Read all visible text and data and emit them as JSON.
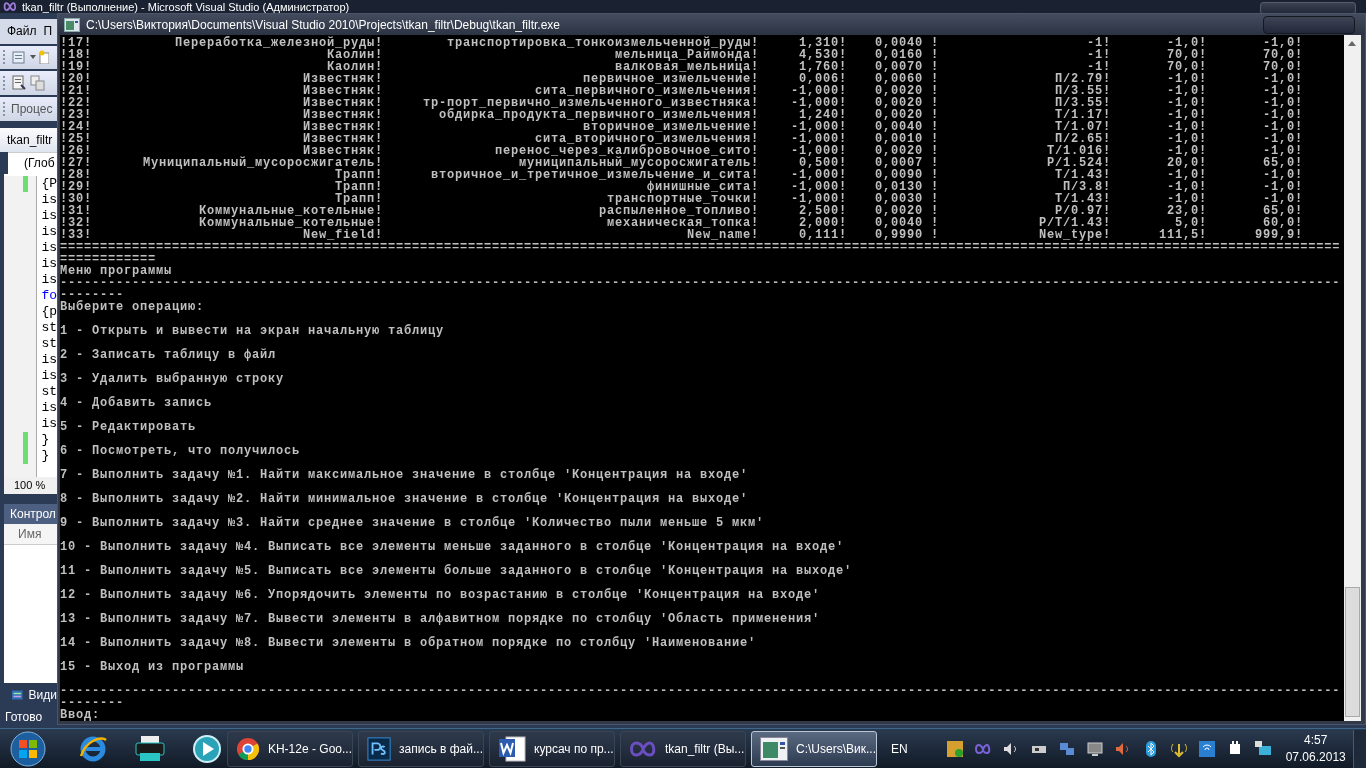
{
  "ide": {
    "title": "tkan_filtr (Выполнение) - Microsoft Visual Studio (Администратор)",
    "menu": [
      "Файл",
      "П"
    ],
    "toolbar_label": "Процес",
    "document_tab": "tkan_filtr",
    "scope_dropdown": "(Глоб",
    "code_lines": [
      {
        "text": "{P",
        "kind": "plain",
        "changed": true
      },
      {
        "text": "is",
        "kind": "plain",
        "changed": false
      },
      {
        "text": "is",
        "kind": "plain",
        "changed": false
      },
      {
        "text": "is",
        "kind": "plain",
        "changed": false
      },
      {
        "text": "is",
        "kind": "plain",
        "changed": false
      },
      {
        "text": "is",
        "kind": "plain",
        "changed": false
      },
      {
        "text": "is",
        "kind": "plain",
        "changed": false
      },
      {
        "text": "fo",
        "kind": "keyword",
        "changed": false
      },
      {
        "text": "{p",
        "kind": "plain",
        "changed": false
      },
      {
        "text": "st",
        "kind": "plain",
        "changed": false
      },
      {
        "text": "st",
        "kind": "plain",
        "changed": false
      },
      {
        "text": "is",
        "kind": "plain",
        "changed": false
      },
      {
        "text": "is",
        "kind": "plain",
        "changed": false
      },
      {
        "text": "st",
        "kind": "plain",
        "changed": false
      },
      {
        "text": "is",
        "kind": "plain",
        "changed": false
      },
      {
        "text": "is",
        "kind": "plain",
        "changed": false
      },
      {
        "text": "}",
        "kind": "plain",
        "changed": true
      },
      {
        "text": "}",
        "kind": "plain",
        "changed": true
      }
    ],
    "zoom": "100 %",
    "panel_title": "Контрол",
    "panel_column": "Имя",
    "bottom_tab": "Види",
    "status": "Готово"
  },
  "console": {
    "title": "C:\\Users\\Виктория\\Documents\\Visual Studio 2010\\Projects\\tkan_filtr\\Debug\\tkan_filtr.exe",
    "rows": [
      [
        "!17!",
        "Переработка_железной_руды!",
        "транспортировка_тонкоизмельченной_руды!",
        "1,310!",
        "0,0040 !",
        "-1!",
        "-1,0!",
        "-1,0!"
      ],
      [
        "!18!",
        "Каолин!",
        "мельница_Раймонда!",
        "4,530!",
        "0,0160 !",
        "-1!",
        "70,0!",
        "70,0!"
      ],
      [
        "!19!",
        "Каолин!",
        "валковая_мельница!",
        "1,760!",
        "0,0070 !",
        "-1!",
        "70,0!",
        "70,0!"
      ],
      [
        "!20!",
        "Известняк!",
        "первичное_измельчение!",
        "0,006!",
        "0,0060 !",
        "П/2.79!",
        "-1,0!",
        "-1,0!"
      ],
      [
        "!21!",
        "Известняк!",
        "сита_первичного_измельчения!",
        "-1,000!",
        "0,0020 !",
        "П/3.55!",
        "-1,0!",
        "-1,0!"
      ],
      [
        "!22!",
        "Известняк!",
        "тр-порт_первично_измельченного_известняка!",
        "-1,000!",
        "0,0020 !",
        "П/3.55!",
        "-1,0!",
        "-1,0!"
      ],
      [
        "!23!",
        "Известняк!",
        "обдирка_продукта_первичного_измельчения!",
        "1,240!",
        "0,0020 !",
        "Т/1.17!",
        "-1,0!",
        "-1,0!"
      ],
      [
        "!24!",
        "Известняк!",
        "вторичное_измельчение!",
        "-1,000!",
        "0,0040 !",
        "Т/1.07!",
        "-1,0!",
        "-1,0!"
      ],
      [
        "!25!",
        "Известняк!",
        "сита_вторичного_измельчения!",
        "-1,000!",
        "0,0010 !",
        "П/2.65!",
        "-1,0!",
        "-1,0!"
      ],
      [
        "!26!",
        "Известняк!",
        "перенос_через_калибровочное_сито!",
        "-1,000!",
        "0,0020 !",
        "Т/1.016!",
        "-1,0!",
        "-1,0!"
      ],
      [
        "!27!",
        "Муниципальный_мусоросжигатель!",
        "муниципальный_мусоросжигатель!",
        "0,500!",
        "0,0007 !",
        "Р/1.524!",
        "20,0!",
        "65,0!"
      ],
      [
        "!28!",
        "Трапп!",
        "вторичное_и_третичное_измельчение_и_сита!",
        "-1,000!",
        "0,0090 !",
        "Т/1.43!",
        "-1,0!",
        "-1,0!"
      ],
      [
        "!29!",
        "Трапп!",
        "финишные_сита!",
        "-1,000!",
        "0,0130 !",
        "П/3.8!",
        "-1,0!",
        "-1,0!"
      ],
      [
        "!30!",
        "Трапп!",
        "транспортные_точки!",
        "-1,000!",
        "0,0030 !",
        "Т/1.43!",
        "-1,0!",
        "-1,0!"
      ],
      [
        "!31!",
        "Коммунальные_котельные!",
        "распыленное_топливо!",
        "2,500!",
        "0,0020 !",
        "Р/0.97!",
        "23,0!",
        "65,0!"
      ],
      [
        "!32!",
        "Коммунальные_котельные!",
        "механическая_топка!",
        "2,000!",
        "0,0040 !",
        "Р/Т/1.43!",
        "5,0!",
        "60,0!"
      ],
      [
        "!33!",
        "New_field!",
        "New_name!",
        "0,111!",
        "0,9990 !",
        "New_type!",
        "111,5!",
        "999,9!"
      ]
    ],
    "rule_top": "================================================================================================================================================================",
    "rule_top_wrap": "============",
    "menu_title": "Меню программы",
    "rule_mid": "----------------------------------------------------------------------------------------------------------------------------------------------------------------",
    "rule_mid_wrap": "--------",
    "prompt": "Выберите операцию:",
    "options": [
      "1 - Открыть и вывести на экран начальную таблицу",
      "2 - Записать таблицу в файл",
      "3 - Удалить выбранную строку",
      "4 - Добавить запись",
      "5 - Редактировать",
      "6 - Посмотреть, что получилось",
      "7 - Выполнить задачу №1. Найти максимальное значение в столбце 'Концентрация на входе'",
      "8 - Выполнить задачу №2. Найти минимальное значение в столбце 'Концентрация на выходе'",
      "9 - Выполнить задачу №3. Найти среднее значение в столбце 'Количество пыли меньше 5 мкм'",
      "10 - Выполнить задачу №4. Выписать все элементы меньше заданного в столбце 'Концентрация на входе'",
      "11 - Выполнить задачу №5. Выписать все элементы больше заданного в столбце 'Концентрация на выходе'",
      "12 - Выполнить задачу №6. Упорядочить элементы по возрастанию в столбце 'Концентрация на входе'",
      "13 - Выполнить задачу №7. Вывести элементы в алфавитном порядке по столбцу 'Область применения'",
      "14 - Выполнить задачу №8. Вывести элементы в обратном порядке по столбцу 'Наименование'",
      "15 - Выход из программы"
    ],
    "rule_bottom": "----------------------------------------------------------------------------------------------------------------------------------------------------------------",
    "rule_bottom_wrap": "--------",
    "input_label": "Ввод:"
  },
  "taskbar": {
    "tasks": [
      {
        "label": "KH-12e - Goo...",
        "kind": "chrome",
        "selected": false
      },
      {
        "label": "запись в фай...",
        "kind": "photoshop",
        "selected": false
      },
      {
        "label": "курсач по пр...",
        "kind": "word",
        "selected": false
      },
      {
        "label": "tkan_filtr (Вы...",
        "kind": "studio",
        "selected": false
      },
      {
        "label": "C:\\Users\\Вик...",
        "kind": "console",
        "selected": true
      }
    ],
    "language": "EN",
    "time": "4:57",
    "date": "07.06.2013"
  }
}
